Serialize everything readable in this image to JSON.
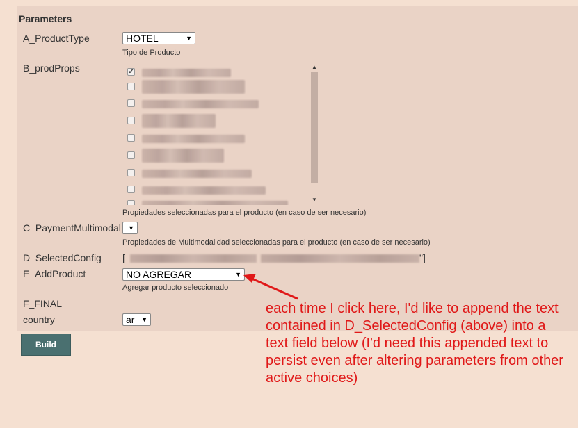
{
  "panel": {
    "title": "Parameters"
  },
  "params": {
    "a": {
      "label": "A_ProductType",
      "value": "HOTEL",
      "help": "Tipo de Producto"
    },
    "b": {
      "label": "B_prodProps",
      "help": "Propiedades seleccionadas para el producto (en caso de ser necesario)",
      "checked_count": 1,
      "total_visible": 9
    },
    "c": {
      "label": "C_PaymentMultimodal",
      "value": "",
      "help": "Propiedades de Multimodalidad seleccionadas para el producto (en caso de ser necesario)"
    },
    "d": {
      "label": "D_SelectedConfig",
      "open": "[",
      "close": "\"]"
    },
    "e": {
      "label": "E_AddProduct",
      "value": "NO AGREGAR",
      "help": "Agregar producto seleccionado"
    },
    "f": {
      "label": "F_FINAL"
    },
    "country": {
      "label": "country",
      "value": "ar"
    }
  },
  "build": {
    "label": "Build"
  },
  "annotation": {
    "text": "each time I click here, I'd like to append the text contained in D_SelectedConfig (above) into a text field below (I'd need this appended text to persist even after altering parameters from other active choices)",
    "color": "#e01818"
  },
  "icons": {
    "check": "check-icon",
    "dropdown": "chevron-down-icon"
  }
}
